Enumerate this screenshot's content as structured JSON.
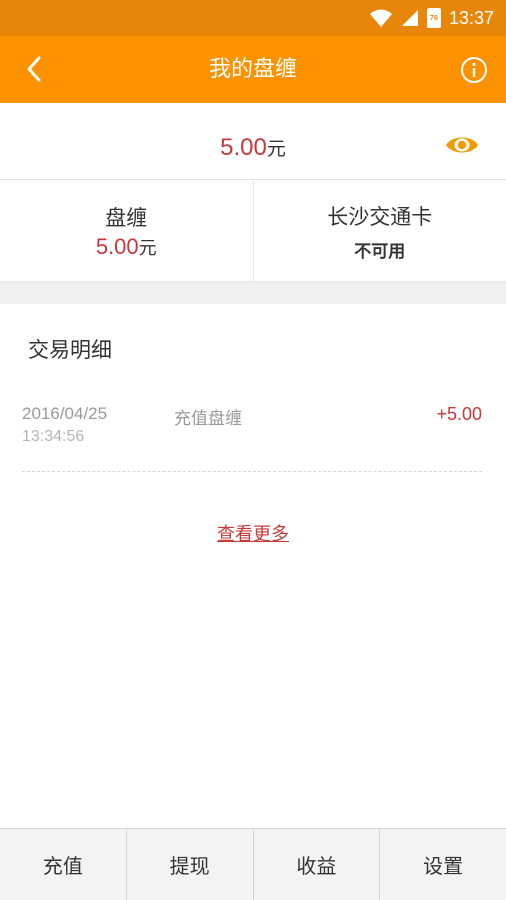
{
  "status_bar": {
    "time": "13:37",
    "battery_level": "76",
    "icons": [
      "wifi-icon",
      "signal-icon",
      "battery-icon"
    ]
  },
  "app_bar": {
    "title": "我的盘缠",
    "back_icon": "chevron-left-icon",
    "info_icon": "info-icon"
  },
  "balance": {
    "amount": "5.00",
    "unit": "元",
    "visibility_icon": "eye-icon"
  },
  "accounts": [
    {
      "name": "盘缠",
      "amount": "5.00",
      "unit": "元"
    },
    {
      "name": "长沙交通卡",
      "status": "不可用"
    }
  ],
  "transactions": {
    "heading": "交易明细",
    "items": [
      {
        "date": "2016/04/25",
        "time": "13:34:56",
        "description": "充值盘缠",
        "amount": "+5.00"
      }
    ],
    "more_label": "查看更多"
  },
  "bottom_bar": {
    "buttons": [
      "充值",
      "提现",
      "收益",
      "设置"
    ]
  },
  "colors": {
    "status_bar": "#e8860a",
    "app_bar": "#fc9200",
    "accent_red": "#c8373a",
    "eye_icon": "#f39a00",
    "section_gap": "#efefef"
  }
}
